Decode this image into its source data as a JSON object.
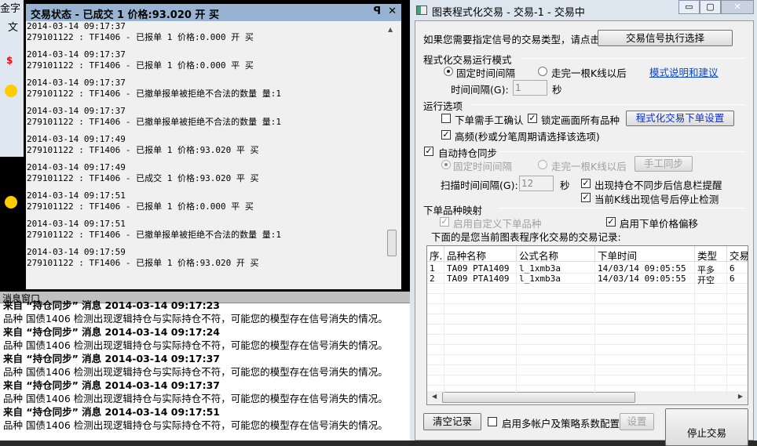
{
  "background_app": {
    "title_fragment": "金字",
    "menu_fragment": "文"
  },
  "status_window": {
    "title": "交易状态 - 已成交 1 价格:93.020 开 买",
    "pin": "ꟼ",
    "close": "✕",
    "entries": [
      {
        "time": "2014-03-14 09:17:37",
        "text": "279101122 : TF1406 - 已报单 1 价格:0.000 开 买"
      },
      {
        "time": "2014-03-14 09:17:37",
        "text": "279101122 : TF1406 - 已报单 1 价格:0.000 平 买"
      },
      {
        "time": "2014-03-14 09:17:37",
        "text": "279101122 : TF1406 - 已撤单报单被拒绝不合法的数量 量:1"
      },
      {
        "time": "2014-03-14 09:17:37",
        "text": "279101122 : TF1406 - 已撤单报单被拒绝不合法的数量 量:1"
      },
      {
        "time": "2014-03-14 09:17:49",
        "text": "279101122 : TF1406 - 已报单 1 价格:93.020 平 买"
      },
      {
        "time": "2014-03-14 09:17:49",
        "text": "279101122 : TF1406 - 已成交 1 价格:93.020 平 买"
      },
      {
        "time": "2014-03-14 09:17:51",
        "text": "279101122 : TF1406 - 已报单 1 价格:0.000 平 买"
      },
      {
        "time": "2014-03-14 09:17:51",
        "text": "279101122 : TF1406 - 已撤单报单被拒绝不合法的数量 量:1"
      },
      {
        "time": "2014-03-14 09:17:59",
        "text": "279101122 : TF1406 - 已报单 1 价格:93.020 开 买"
      }
    ]
  },
  "message_window": {
    "title": "消息窗口",
    "lines": [
      {
        "bold": true,
        "text": "来自 “持仓同步” 消息 2014-03-14 09:17:23"
      },
      {
        "bold": false,
        "text": "品种 国债1406 检测出现逻辑持仓与实际持仓不符，可能您的模型存在信号消失的情况。"
      },
      {
        "bold": true,
        "text": "来自 “持仓同步” 消息 2014-03-14 09:17:24"
      },
      {
        "bold": false,
        "text": "品种 国债1406 检测出现逻辑持仓与实际持仓不符，可能您的模型存在信号消失的情况。"
      },
      {
        "bold": true,
        "text": "来自 “持仓同步” 消息 2014-03-14 09:17:37"
      },
      {
        "bold": false,
        "text": "品种 国债1406 检测出现逻辑持仓与实际持仓不符，可能您的模型存在信号消失的情况。"
      },
      {
        "bold": true,
        "text": "来自 “持仓同步” 消息 2014-03-14 09:17:37"
      },
      {
        "bold": false,
        "text": "品种 国债1406 检测出现逻辑持仓与实际持仓不符，可能您的模型存在信号消失的情况。"
      },
      {
        "bold": true,
        "text": "来自 “持仓同步” 消息 2014-03-14 09:17:51"
      },
      {
        "bold": false,
        "text": "品种 国债1406 检测出现逻辑持仓与实际持仓不符，可能您的模型存在信号消失的情况。"
      }
    ]
  },
  "dialog": {
    "title": "图表程式化交易 - 交易-1 - 交易中",
    "prompt": "如果您需要指定信号的交易类型，请点击",
    "signal_button": "交易信号执行选择",
    "mode_section": "程式化交易运行模式",
    "mode_fixed": "固定时间间隔",
    "mode_bar": "走完一根K线以后",
    "mode_link": "模式说明和建议",
    "interval_label": "时间间隔(G):",
    "interval_value": "1",
    "seconds": "秒",
    "options_section": "运行选项",
    "manual_confirm": "下单需手工确认",
    "lock_all": "锁定画面所有品种",
    "order_settings_button": "程式化交易下单设置",
    "high_freq": "高频(秒或分笔周期请选择该选项)",
    "auto_sync": "自动持仓同步",
    "sync_fixed": "固定时间间隔",
    "sync_bar": "走完一根K线以后",
    "manual_sync_button": "手工同步",
    "scan_label": "扫描时间间隔(G):",
    "scan_value": "12",
    "scan_seconds": "秒",
    "notify_mismatch": "出现持仓不同步后信息栏提醒",
    "stop_check": "当前K线出现信号后停止检测",
    "mapping_section": "下单品种映射",
    "custom_symbol": "启用自定义下单品种",
    "price_offset": "启用下单价格偏移",
    "records_label": "下面的是您当前图表程序化交易的交易记录:",
    "table": {
      "headers": [
        "序.",
        "品种名称",
        "公式名称",
        "下单时间",
        "类型",
        "交易"
      ],
      "rows": [
        [
          "1",
          "TA09 PTA1409",
          "l_1xmb3a",
          "14/03/14 09:05:55",
          "平多",
          "6"
        ],
        [
          "2",
          "TA09 PTA1409",
          "l_1xmb3a",
          "14/03/14 09:05:55",
          "开空",
          "6"
        ]
      ]
    },
    "clear_button": "清空记录",
    "multi_account": "启用多帐户及策略系数配置",
    "settings_button": "设置",
    "stop_button": "停止交易"
  }
}
